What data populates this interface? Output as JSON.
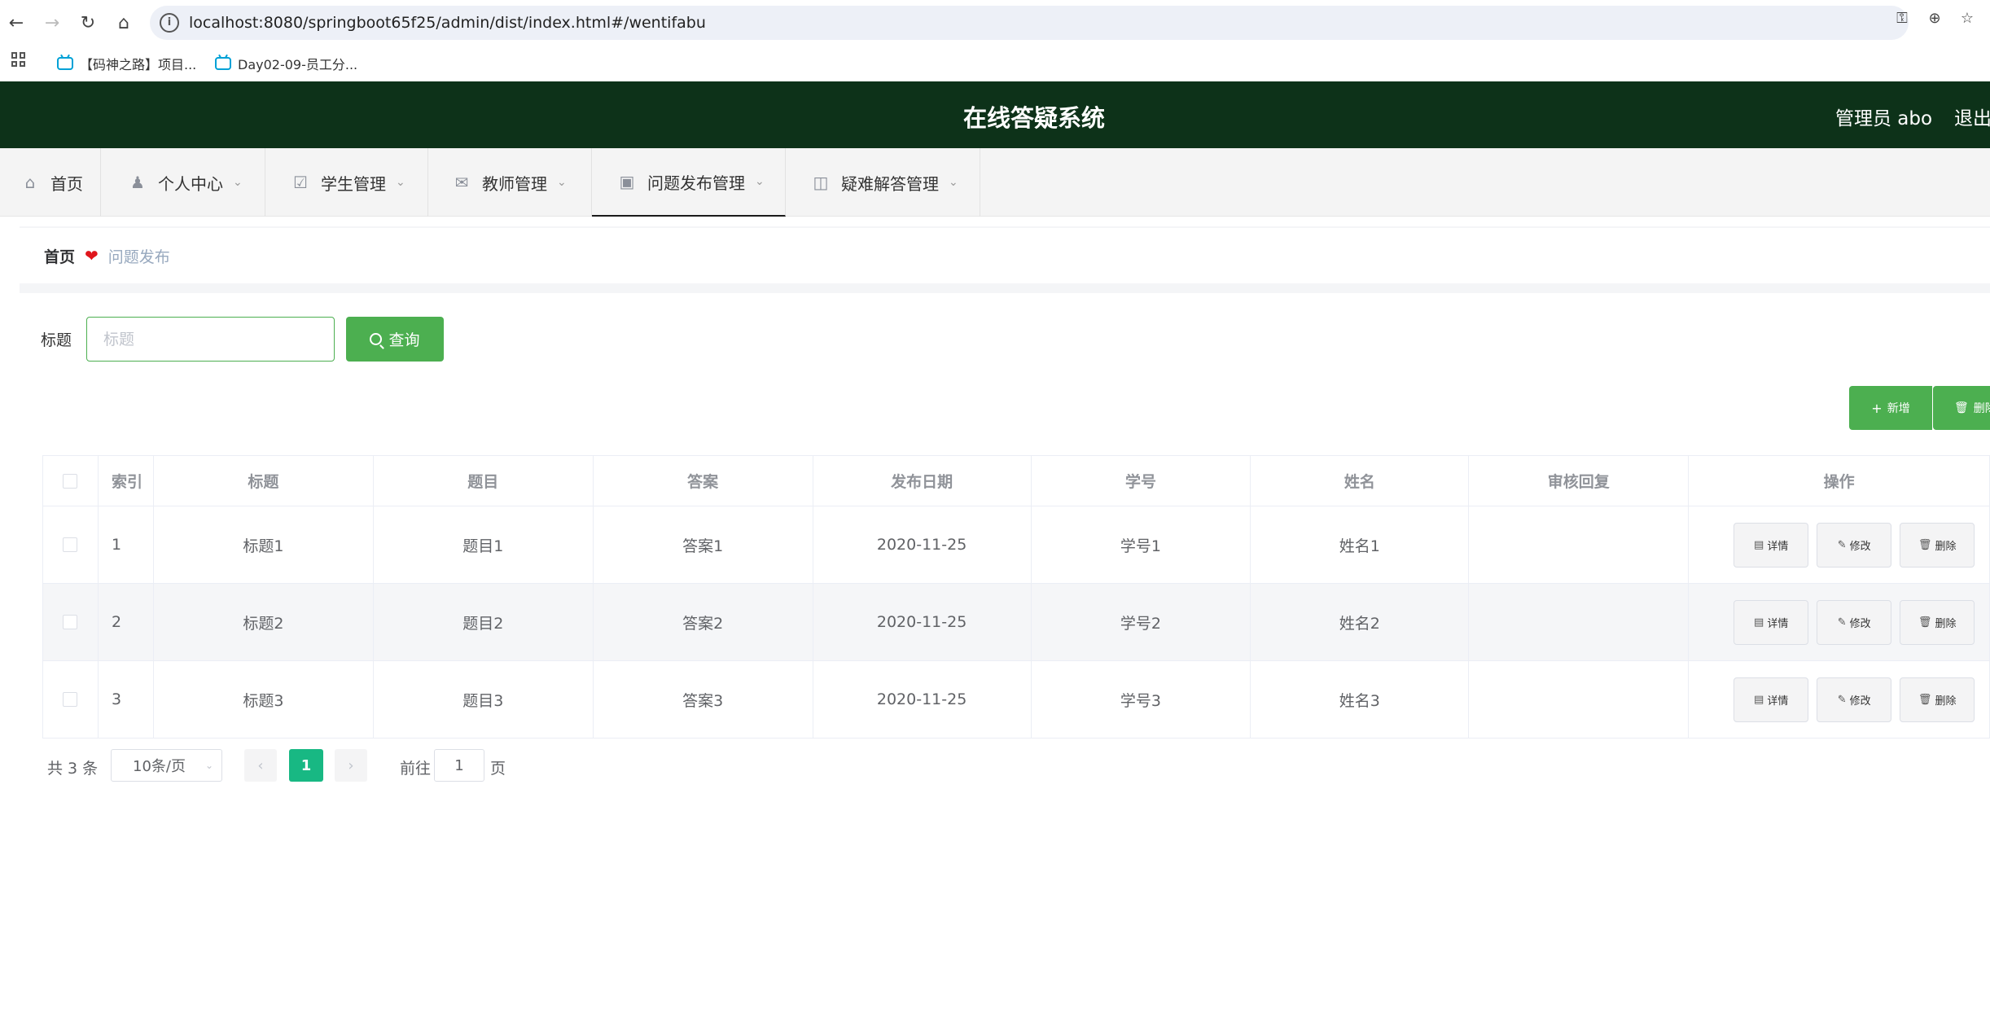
{
  "browser": {
    "url": "localhost:8080/springboot65f25/admin/dist/index.html#/wentifabu",
    "bookmarks": [
      "【码神之路】项目...",
      "Day02-09-员工分..."
    ]
  },
  "header": {
    "title": "在线答疑系统",
    "user": "管理员 abo",
    "logout": "退出"
  },
  "menu": {
    "items": [
      {
        "label": "首页"
      },
      {
        "label": "个人中心"
      },
      {
        "label": "学生管理"
      },
      {
        "label": "教师管理"
      },
      {
        "label": "问题发布管理"
      },
      {
        "label": "疑难解答管理"
      }
    ]
  },
  "breadcrumb": {
    "home": "首页",
    "current": "问题发布"
  },
  "search": {
    "label": "标题",
    "placeholder": "标题",
    "button": "查询"
  },
  "actions": {
    "add": "新增",
    "delete": "删除"
  },
  "table": {
    "headers": [
      "索引",
      "标题",
      "题目",
      "答案",
      "发布日期",
      "学号",
      "姓名",
      "审核回复",
      "操作"
    ],
    "rows": [
      {
        "idx": "1",
        "title": "标题1",
        "question": "题目1",
        "answer": "答案1",
        "date": "2020-11-25",
        "no": "学号1",
        "name": "姓名1",
        "review": ""
      },
      {
        "idx": "2",
        "title": "标题2",
        "question": "题目2",
        "answer": "答案2",
        "date": "2020-11-25",
        "no": "学号2",
        "name": "姓名2",
        "review": ""
      },
      {
        "idx": "3",
        "title": "标题3",
        "question": "题目3",
        "answer": "答案3",
        "date": "2020-11-25",
        "no": "学号3",
        "name": "姓名3",
        "review": ""
      }
    ],
    "row_actions": {
      "detail": "详情",
      "edit": "修改",
      "delete": "删除"
    }
  },
  "pagination": {
    "total": "共 3 条",
    "page_size": "10条/页",
    "current_page": "1",
    "goto_label": "前往",
    "goto_value": "1",
    "page_suffix": "页"
  }
}
